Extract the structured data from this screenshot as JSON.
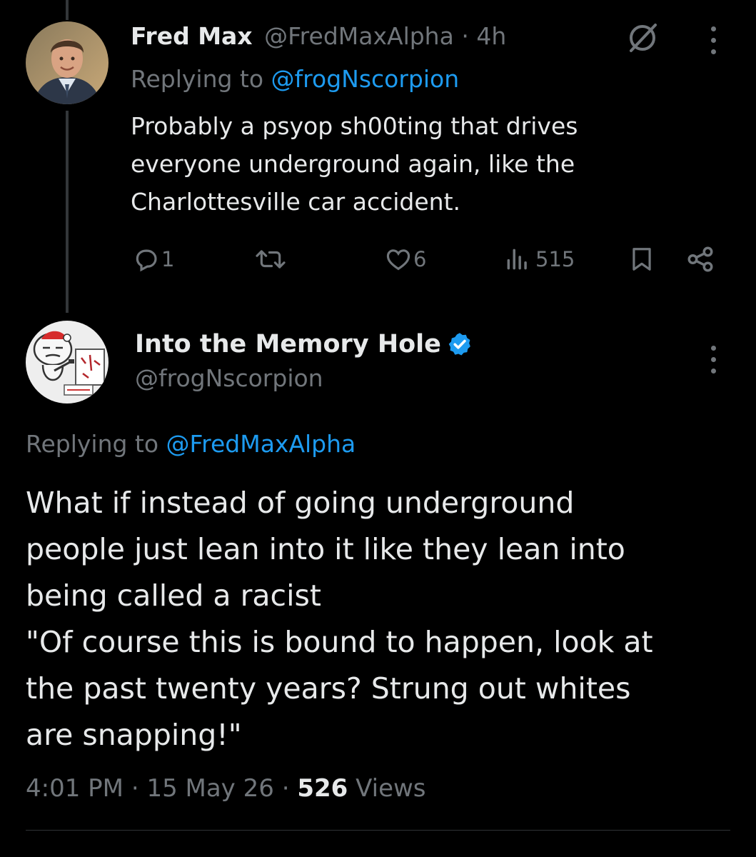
{
  "reply_tweet": {
    "display_name": "Fred Max",
    "handle": "@FredMaxAlpha",
    "separator": "·",
    "time_ago": "4h",
    "replying_prefix": "Replying to",
    "replying_to": "@frogNscorpion",
    "text": "Probably a psyop sh00ting that drives everyone underground again, like the Charlottesville car accident.",
    "reply_count": "1",
    "retweet_count": "",
    "like_count": "6",
    "view_count": "515"
  },
  "main_tweet": {
    "display_name": "Into the Memory Hole",
    "handle": "@frogNscorpion",
    "verified": true,
    "replying_prefix": "Replying to",
    "replying_to": "@FredMaxAlpha",
    "text_lines": [
      "What if instead of going underground",
      "people just lean into it like they lean into",
      "being called a racist",
      "\"Of course this is bound to happen, look at",
      "the past twenty years? Strung out whites",
      "are snapping!\""
    ],
    "time": "4:01 PM",
    "date": "15 May 26",
    "separator": "·",
    "views_count": "526",
    "views_label": "Views"
  },
  "colors": {
    "background": "#000000",
    "text": "#e7e9ea",
    "muted": "#71767b",
    "link": "#1d9bf0",
    "verified": "#1d9bf0"
  }
}
